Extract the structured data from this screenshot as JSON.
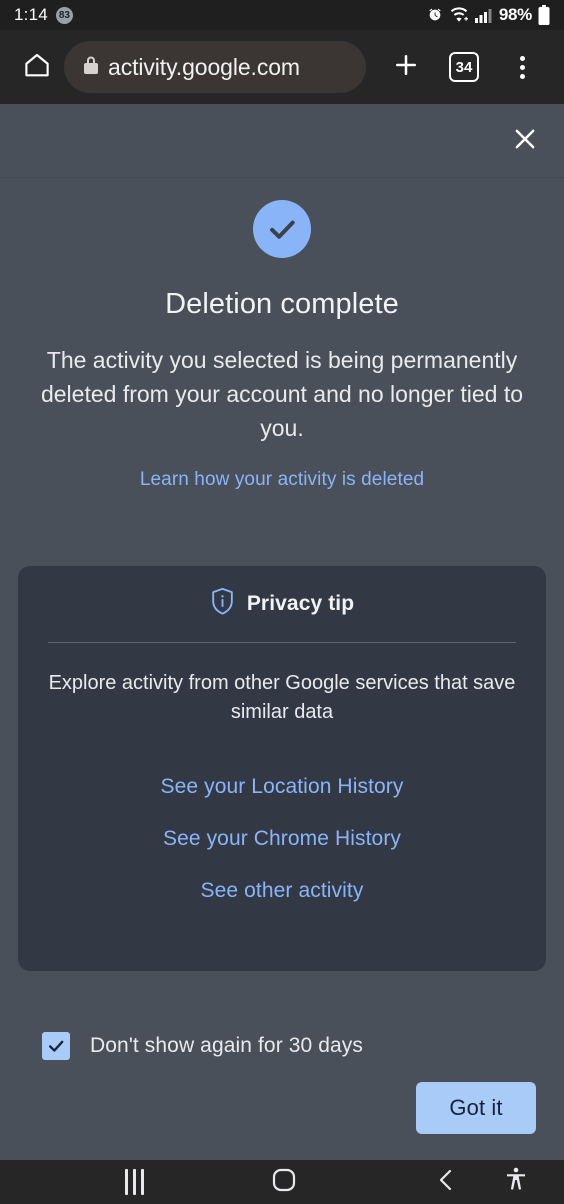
{
  "status_bar": {
    "clock": "1:14",
    "notification_badge": "83",
    "battery_percent": "98%",
    "icons": [
      "alarm-icon",
      "wifi-icon",
      "cellular-signal-icon",
      "battery-icon"
    ]
  },
  "browser": {
    "home_icon": "home-icon",
    "lock_icon": "lock-icon",
    "url": "activity.google.com",
    "new_tab_icon": "plus-icon",
    "tab_count": "34",
    "menu_icon": "overflow-menu-icon"
  },
  "dialog": {
    "close_icon": "close-icon",
    "status_icon": "check-circle-icon",
    "title": "Deletion complete",
    "subtitle": "The activity you selected is being permanently deleted from your account and no longer tied to you.",
    "learn_link": "Learn how your activity is deleted",
    "privacy_card": {
      "icon": "shield-info-icon",
      "heading": "Privacy tip",
      "description": "Explore activity from other Google services that save similar data",
      "links": [
        "See your Location History",
        "See your Chrome History",
        "See other activity"
      ]
    },
    "dont_show_checkbox": {
      "label": "Don't show again for 30 days",
      "checked": true
    },
    "confirm_button": "Got it"
  },
  "nav_bar": {
    "recents": "recent-apps-icon",
    "home": "home-button-icon",
    "back": "back-button-icon",
    "accessibility": "accessibility-icon"
  },
  "colors": {
    "dialog_bg": "#4a505a",
    "card_bg": "#333944",
    "accent_blue": "#8ab4f8",
    "button_blue": "#a8cbf7",
    "toolbar_bg": "#262626",
    "status_bg": "#1f1f1f"
  }
}
